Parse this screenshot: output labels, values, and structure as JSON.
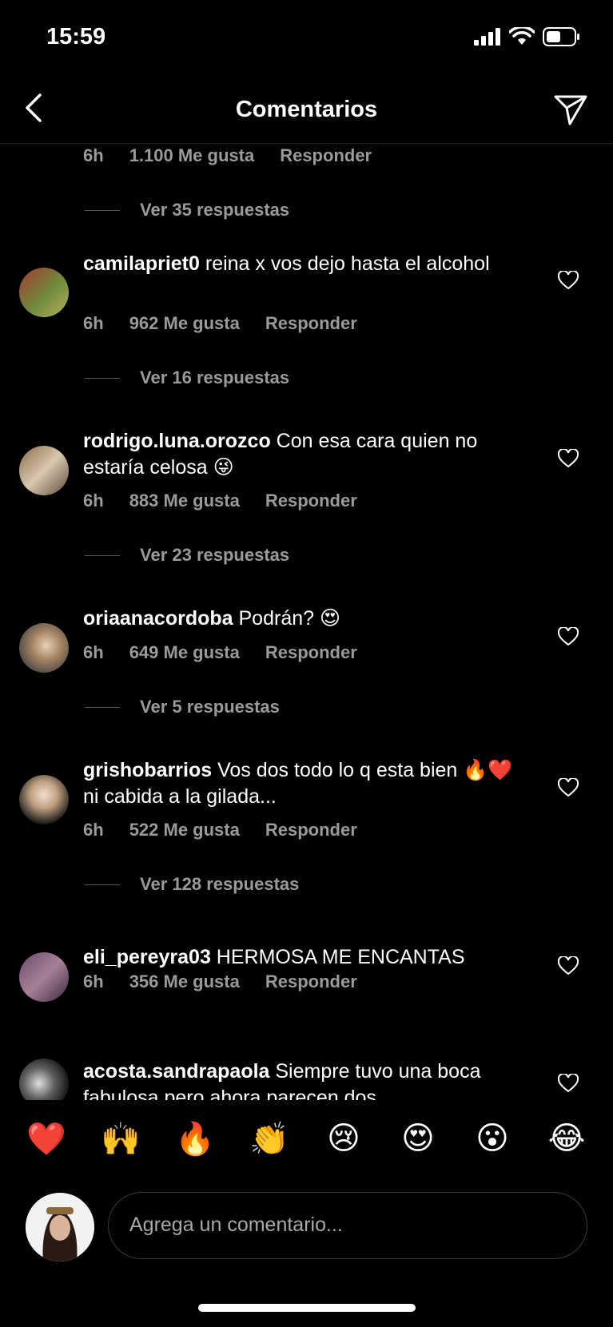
{
  "status_bar": {
    "time": "15:59"
  },
  "header": {
    "title": "Comentarios"
  },
  "top_meta": {
    "time": "6h",
    "likes": "1.100 Me gusta",
    "reply": "Responder"
  },
  "top_replies": "Ver 35 respuestas",
  "comments": [
    {
      "user": "camilapriet0",
      "text": " reina x vos dejo hasta el alcohol",
      "time": "6h",
      "likes": "962 Me gusta",
      "reply": "Responder",
      "replies": "Ver 16 respuestas"
    },
    {
      "user": "rodrigo.luna.orozco",
      "text": " Con esa cara quien no estaría celosa 😜",
      "time": "6h",
      "likes": "883 Me gusta",
      "reply": "Responder",
      "replies": "Ver 23 respuestas"
    },
    {
      "user": "oriaanacordoba",
      "text": " Podrán? 😍",
      "time": "6h",
      "likes": "649 Me gusta",
      "reply": "Responder",
      "replies": "Ver 5 respuestas"
    },
    {
      "user": "grishobarrios",
      "text": " Vos dos todo lo q esta bien 🔥❤️ ni cabida a la gilada...",
      "time": "6h",
      "likes": "522 Me gusta",
      "reply": "Responder",
      "replies": "Ver 128 respuestas"
    },
    {
      "user": "eli_pereyra03",
      "text": " HERMOSA ME ENCANTAS",
      "time": "6h",
      "likes": "356 Me gusta",
      "reply": "Responder"
    },
    {
      "user": "acosta.sandrapaola",
      "text": " Siempre tuvo una boca fabulosa pero ahora parecen dos"
    }
  ],
  "reactions": [
    "❤️",
    "🙌",
    "🔥",
    "👏",
    "😢",
    "😍",
    "😮",
    "😂"
  ],
  "composer": {
    "placeholder": "Agrega un comentario..."
  },
  "icons": {
    "back": "chevron-left-icon",
    "send": "paper-plane-icon",
    "like": "heart-outline-icon"
  }
}
